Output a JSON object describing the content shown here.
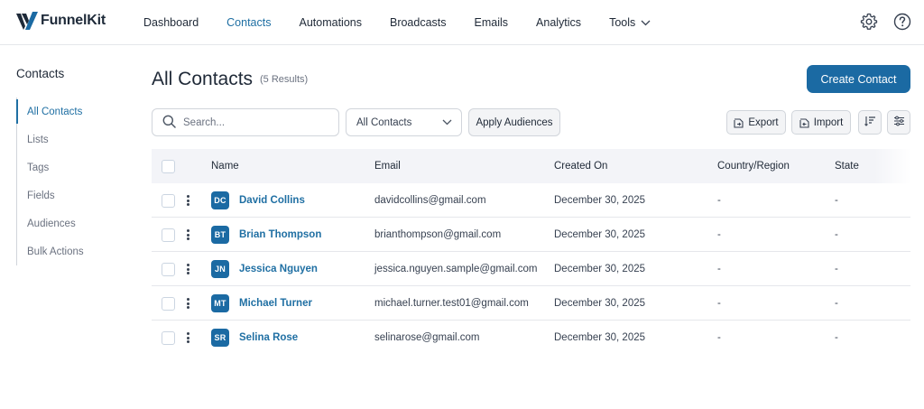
{
  "brand": {
    "name": "FunnelKit"
  },
  "nav": {
    "items": [
      {
        "label": "Dashboard",
        "active": false
      },
      {
        "label": "Contacts",
        "active": true
      },
      {
        "label": "Automations",
        "active": false
      },
      {
        "label": "Broadcasts",
        "active": false
      },
      {
        "label": "Emails",
        "active": false
      },
      {
        "label": "Analytics",
        "active": false
      },
      {
        "label": "Tools",
        "active": false
      }
    ],
    "icons": [
      "gear-icon",
      "help-icon"
    ]
  },
  "sidebar": {
    "title": "Contacts",
    "items": [
      {
        "label": "All Contacts",
        "active": true
      },
      {
        "label": "Lists",
        "active": false
      },
      {
        "label": "Tags",
        "active": false
      },
      {
        "label": "Fields",
        "active": false
      },
      {
        "label": "Audiences",
        "active": false
      },
      {
        "label": "Bulk Actions",
        "active": false
      }
    ]
  },
  "main": {
    "title": "All Contacts",
    "results": "(5 Results)",
    "create_label": "Create Contact",
    "search": {
      "placeholder": "Search...",
      "value": ""
    },
    "filter": {
      "selected": "All Contacts"
    },
    "apply_label": "Apply Audiences",
    "export_label": "Export",
    "import_label": "Import"
  },
  "table": {
    "columns": {
      "name": "Name",
      "email": "Email",
      "created": "Created On",
      "country": "Country/Region",
      "state": "State"
    },
    "rows": [
      {
        "initials": "DC",
        "name": "David Collins",
        "email": "davidcollins@gmail.com",
        "created": "December 30, 2025",
        "country": "-",
        "state": "-"
      },
      {
        "initials": "BT",
        "name": "Brian Thompson",
        "email": "brianthompson@gmail.com",
        "created": "December 30, 2025",
        "country": "-",
        "state": "-"
      },
      {
        "initials": "JN",
        "name": "Jessica Nguyen",
        "email": "jessica.nguyen.sample@gmail.com",
        "created": "December 30, 2025",
        "country": "-",
        "state": "-"
      },
      {
        "initials": "MT",
        "name": "Michael Turner",
        "email": "michael.turner.test01@gmail.com",
        "created": "December 30, 2025",
        "country": "-",
        "state": "-"
      },
      {
        "initials": "SR",
        "name": "Selina Rose",
        "email": "selinarose@gmail.com",
        "created": "December 30, 2025",
        "country": "-",
        "state": "-"
      }
    ]
  },
  "colors": {
    "accent": "#1b6aa3",
    "link": "#1f6fa3",
    "header_bg": "#f3f4f8",
    "border": "#e5e7eb"
  }
}
